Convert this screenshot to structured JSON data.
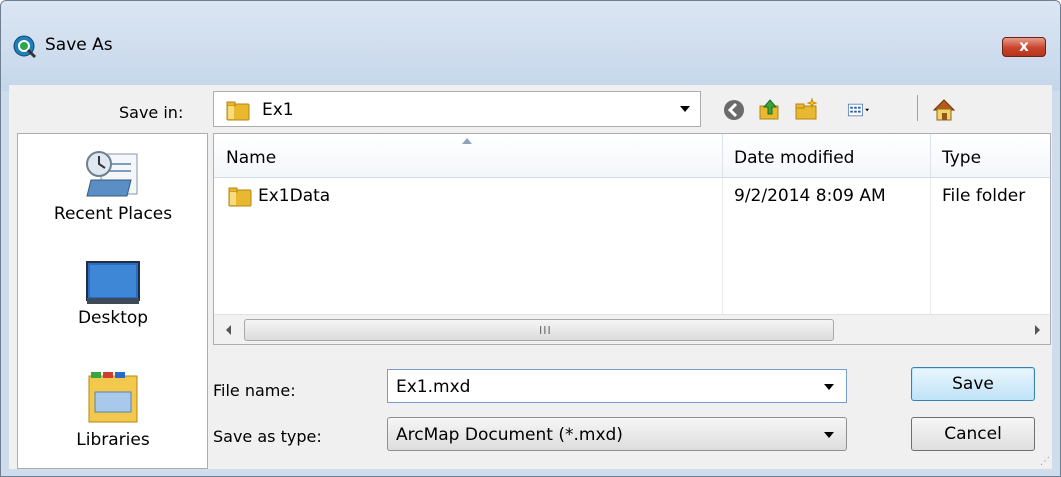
{
  "window": {
    "title": "Save As",
    "close_label": "x",
    "app_icon": "arcmap-globe-icon"
  },
  "toolbar": {
    "save_in_label": "Save in:",
    "save_in_value": "Ex1",
    "buttons": [
      "back-icon",
      "up-folder-icon",
      "new-folder-icon",
      "view-menu-icon",
      "home-icon"
    ]
  },
  "places": [
    {
      "label": "Recent Places",
      "icon": "recent-places-icon"
    },
    {
      "label": "Desktop",
      "icon": "desktop-icon"
    },
    {
      "label": "Libraries",
      "icon": "libraries-icon"
    }
  ],
  "file_list": {
    "columns": [
      "Name",
      "Date modified",
      "Type"
    ],
    "rows": [
      {
        "name": "Ex1Data",
        "date": "9/2/2014 8:09 AM",
        "type": "File folder",
        "icon": "folder-icon"
      }
    ],
    "scroll_grip": "III"
  },
  "form": {
    "file_name_label": "File name:",
    "file_name_value": "Ex1.mxd",
    "save_type_label": "Save as type:",
    "save_type_value": "ArcMap Document (*.mxd)"
  },
  "buttons": {
    "save": "Save",
    "cancel": "Cancel"
  },
  "colors": {
    "titlebar": "#cfdcec",
    "close": "#c8452b",
    "folder": "#e8b830"
  }
}
